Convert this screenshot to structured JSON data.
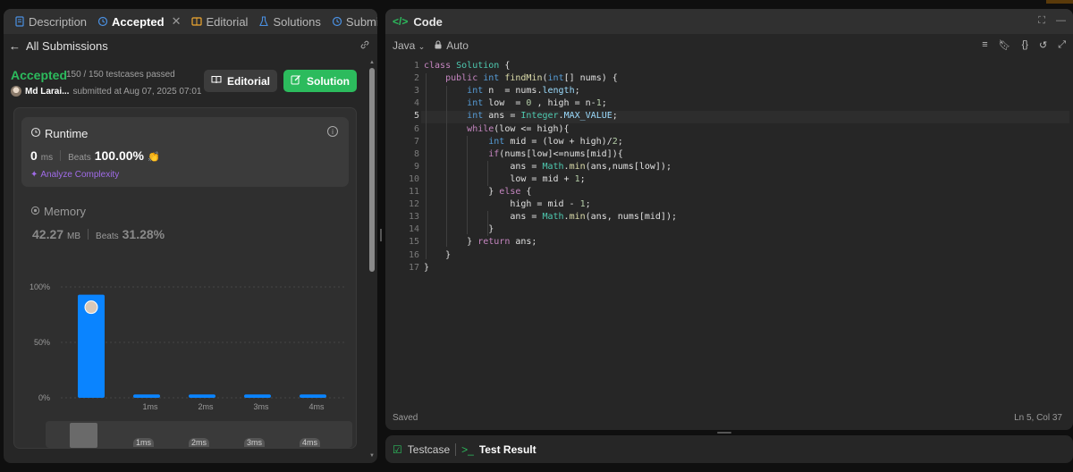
{
  "left_tabs": [
    {
      "label": "Description",
      "icon": "description-icon",
      "active": false
    },
    {
      "label": "Accepted",
      "icon": "history-icon",
      "active": true
    },
    {
      "label": "Editorial",
      "icon": "book-icon",
      "active": false
    },
    {
      "label": "Solutions",
      "icon": "flask-icon",
      "active": false
    },
    {
      "label": "Submissions",
      "icon": "history-icon",
      "active": false
    }
  ],
  "subheader": {
    "back_label": "All Submissions"
  },
  "result": {
    "status": "Accepted",
    "passed": "150 / 150 testcases passed",
    "user": "Md Larai...",
    "submitted": "submitted at Aug 07, 2025 07:01"
  },
  "buttons": {
    "editorial": "Editorial",
    "solution": "Solution"
  },
  "runtime": {
    "title": "Runtime",
    "value": "0",
    "unit": "ms",
    "beats_label": "Beats",
    "beats_value": "100.00%",
    "analyze": "Analyze Complexity"
  },
  "memory": {
    "title": "Memory",
    "value": "42.27",
    "unit": "MB",
    "beats_label": "Beats",
    "beats_value": "31.28%"
  },
  "chart_data": {
    "type": "bar",
    "categories": [
      "",
      "1ms",
      "2ms",
      "3ms",
      "4ms"
    ],
    "values": [
      93,
      3,
      3,
      3,
      3
    ],
    "yticks": [
      "100%",
      "50%",
      "0%"
    ],
    "ylim": [
      0,
      100
    ],
    "colors": {
      "bar": "#0a84ff"
    },
    "mini_labels": [
      "1ms",
      "2ms",
      "3ms",
      "4ms"
    ]
  },
  "code_panel": {
    "title": "Code",
    "language": "Java",
    "mode": "Auto",
    "status": "Saved",
    "cursor": "Ln 5, Col 37"
  },
  "code_lines": [
    "class Solution {",
    "    public int findMin(int[] nums) {",
    "        int n  = nums.length;",
    "        int low  = 0 , high = n-1;",
    "        int ans = Integer.MAX_VALUE;",
    "        while(low <= high){",
    "            int mid = (low + high)/2;",
    "            if(nums[low]<=nums[mid]){",
    "                ans = Math.min(ans,nums[low]);",
    "                low = mid + 1;",
    "            } else {",
    "                high = mid - 1;",
    "                ans = Math.min(ans, nums[mid]);",
    "            }",
    "        } return ans;",
    "    }",
    "}"
  ],
  "bottom_tabs": {
    "testcase": "Testcase",
    "result": "Test Result"
  },
  "colors": {
    "accent_green": "#2cbb5d",
    "bar_blue": "#0a84ff",
    "purple": "#a06be8"
  }
}
